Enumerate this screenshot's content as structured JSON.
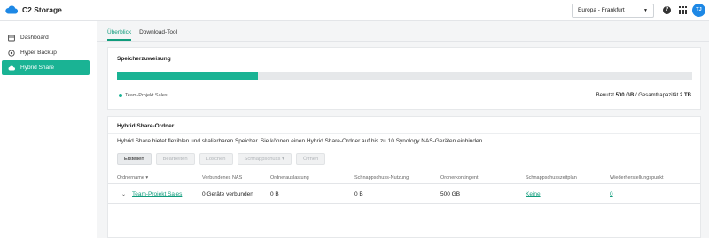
{
  "app": {
    "title": "C2 Storage",
    "brand_color": "#1e88e5",
    "accent_color": "#1ab394"
  },
  "header": {
    "region_value": "Europa - Frankfurt",
    "help_icon": "help-icon",
    "apps_icon": "apps-grid-icon",
    "avatar_initials": "TJ"
  },
  "sidebar": {
    "items": [
      {
        "label": "Dashboard",
        "icon": "dashboard-icon",
        "active": false
      },
      {
        "label": "Hyper Backup",
        "icon": "backup-icon",
        "active": false
      },
      {
        "label": "Hybrid Share",
        "icon": "cloud-icon",
        "active": true
      }
    ]
  },
  "tabs": [
    {
      "label": "Überblick",
      "active": true
    },
    {
      "label": "Download-Tool",
      "active": false
    }
  ],
  "storage": {
    "title": "Speicherzuweisung",
    "used_fraction": 0.245,
    "legend_label": "Team-Projekt Sales",
    "usage_prefix": "Benutzt ",
    "used_value": "500 GB",
    "usage_mid": " / Gesamtkapazität ",
    "total_value": "2 TB"
  },
  "hybrid": {
    "title": "Hybrid Share-Ordner",
    "description": "Hybrid Share bietet flexiblen und skalierbaren Speicher. Sie können einen Hybrid Share-Ordner auf bis zu 10 Synology NAS-Geräten einbinden.",
    "buttons": {
      "create": "Erstellen",
      "edit": "Bearbeiten",
      "delete": "Löschen",
      "snapshot": "Schnappschuss",
      "open": "Öffnen"
    },
    "columns": {
      "name": "Ordnername",
      "nas": "Verbundenes NAS",
      "usage": "Ordnerauslastung",
      "snapshot_usage": "Schnappschuss-Nutzung",
      "quota": "Ordnerkontingent",
      "snapshot_plan": "Schnappschusszeitplan",
      "restore_point": "Wiederherstellungspunkt"
    },
    "rows": [
      {
        "name": "Team-Projekt Sales",
        "nas": "0 Geräte verbunden",
        "usage": "0 B",
        "snapshot_usage": "0 B",
        "quota": "500 GB",
        "snapshot_plan": "Keine",
        "restore_point": "0"
      }
    ]
  }
}
